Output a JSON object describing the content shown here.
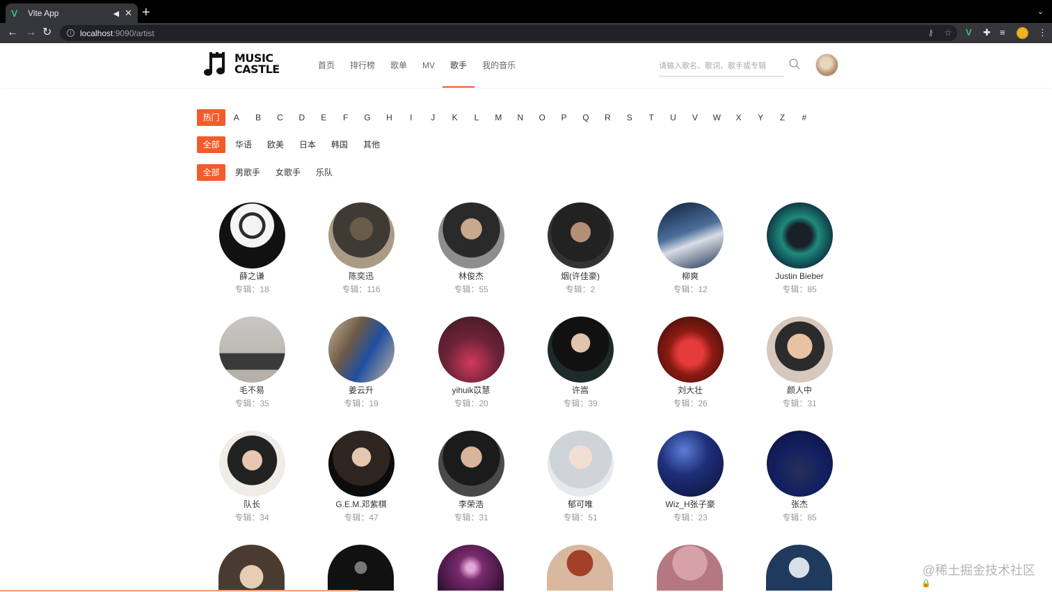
{
  "browser": {
    "tab_title": "Vite App",
    "url_host": "localhost",
    "url_path": ":9090/artist"
  },
  "header": {
    "logo_line1": "MUSIC",
    "logo_line2": "CASTLE",
    "nav": [
      "首页",
      "排行榜",
      "歌单",
      "MV",
      "歌手",
      "我的音乐"
    ],
    "active_nav": "歌手",
    "search_placeholder": "请输入歌名、歌词、歌手或专辑"
  },
  "filters": {
    "letters": [
      "热门",
      "A",
      "B",
      "C",
      "D",
      "E",
      "F",
      "G",
      "H",
      "I",
      "J",
      "K",
      "L",
      "M",
      "N",
      "O",
      "P",
      "Q",
      "R",
      "S",
      "T",
      "U",
      "V",
      "W",
      "X",
      "Y",
      "Z",
      "#"
    ],
    "areas": [
      "全部",
      "华语",
      "欧美",
      "日本",
      "韩国",
      "其他"
    ],
    "types": [
      "全部",
      "男歌手",
      "女歌手",
      "乐队"
    ]
  },
  "album_prefix": "专辑：",
  "artists": [
    {
      "name": "薛之谦",
      "albums": 18
    },
    {
      "name": "陈奕迅",
      "albums": 116
    },
    {
      "name": "林俊杰",
      "albums": 55
    },
    {
      "name": "烟(许佳豪)",
      "albums": 2
    },
    {
      "name": "柳爽",
      "albums": 12
    },
    {
      "name": "Justin Bieber",
      "albums": 85
    },
    {
      "name": "毛不易",
      "albums": 35
    },
    {
      "name": "姜云升",
      "albums": 19
    },
    {
      "name": "yihuik苡慧",
      "albums": 20
    },
    {
      "name": "许嵩",
      "albums": 39
    },
    {
      "name": "刘大壮",
      "albums": 26
    },
    {
      "name": "颜人中",
      "albums": 31
    },
    {
      "name": "队长",
      "albums": 34
    },
    {
      "name": "G.E.M.邓紫棋",
      "albums": 47
    },
    {
      "name": "李荣浩",
      "albums": 31
    },
    {
      "name": "郁可唯",
      "albums": 51
    },
    {
      "name": "Wiz_H张子豪",
      "albums": 23
    },
    {
      "name": "张杰",
      "albums": 85
    }
  ],
  "watermark": "@稀土掘金技术社区"
}
